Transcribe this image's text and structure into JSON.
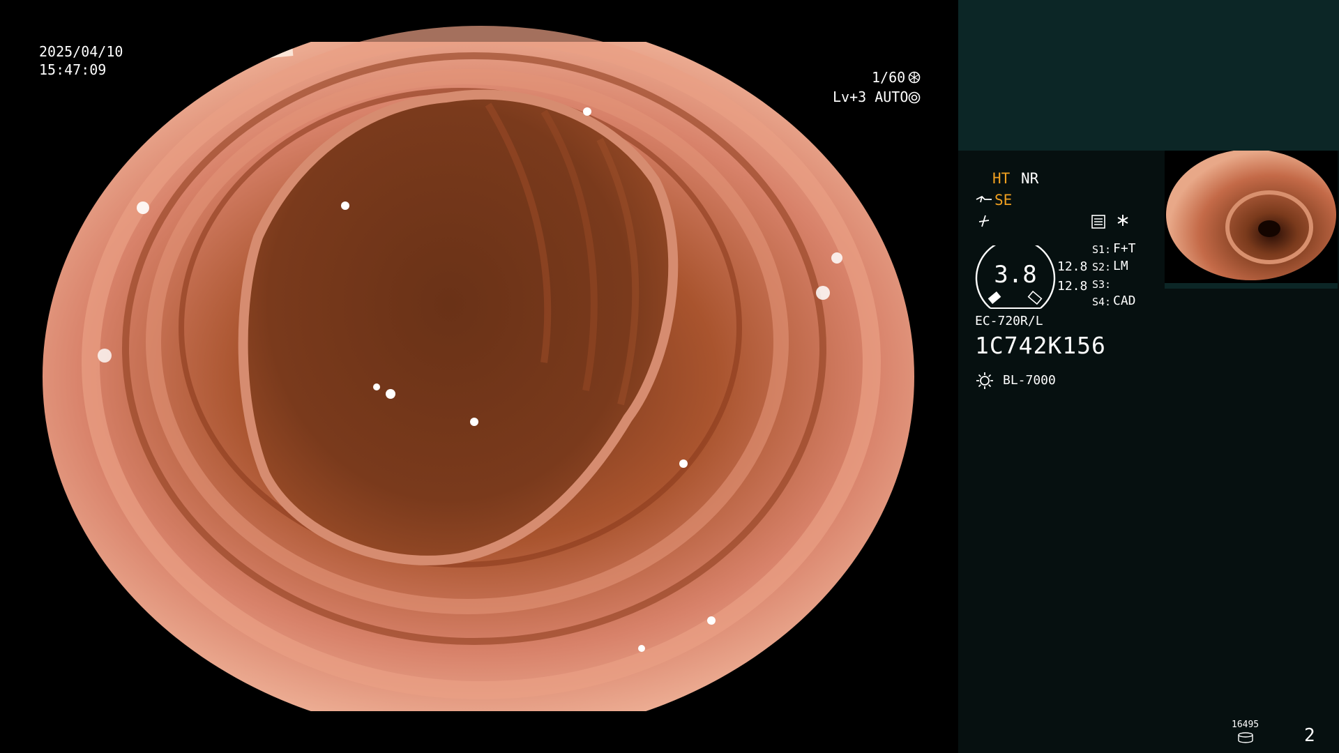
{
  "capture": {
    "date": "2025/04/10",
    "time": "15:47:09",
    "shutter": "1/60",
    "iris": "Lv+3 AUTO"
  },
  "panel": {
    "ht": "HT",
    "nr": "NR",
    "se": "SE",
    "gauge_value": "3.8",
    "gauge_right_1": "12.8",
    "gauge_right_2": "12.8",
    "s1_key": "S1:",
    "s1_val": "F+T",
    "s2_key": "S2:",
    "s2_val": "LM",
    "s3_key": "S3:",
    "s3_val": "",
    "s4_key": "S4:",
    "s4_val": "CAD",
    "scope_model": "EC-720R/L",
    "serial": "1C742K156",
    "light_source": "BL-7000",
    "counter": "16495",
    "page_number": "2"
  },
  "icons": {
    "shutter": "aperture-icon",
    "iris": "iris-icon",
    "scope": "scope-icon",
    "freeze": "freeze-icon",
    "menu": "menu-icon",
    "star": "asterisk-icon",
    "light": "sun-icon",
    "storage": "disk-icon"
  },
  "colors": {
    "panel_bg": "#061010",
    "panel_top": "#0c2626",
    "accent": "#f0a020",
    "tissue": "#c8745a",
    "lumen": "#5a2a16"
  }
}
